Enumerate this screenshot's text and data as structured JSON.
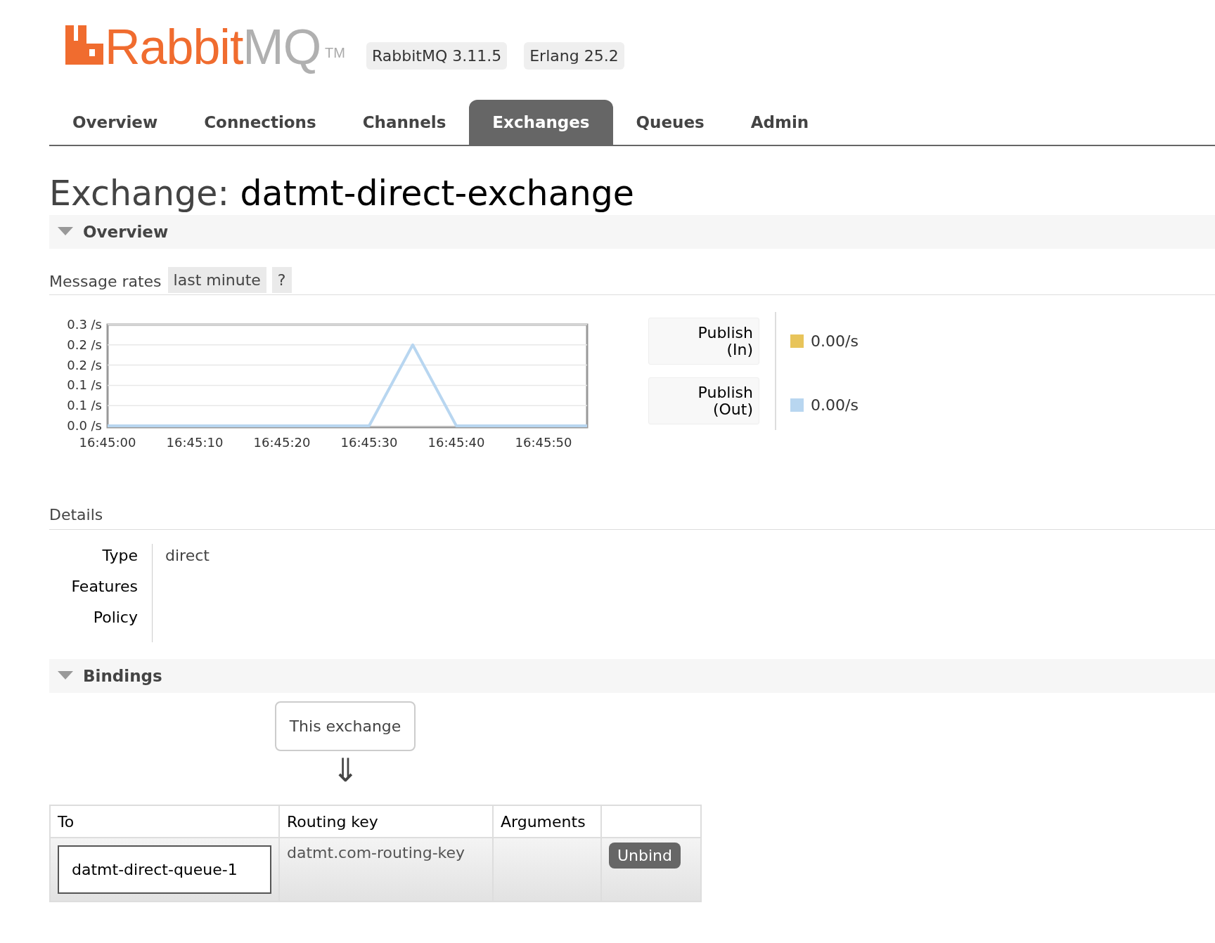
{
  "logo": {
    "text_a": "Rabbit",
    "text_b": "MQ",
    "trademark": "TM"
  },
  "versions": [
    "RabbitMQ 3.11.5",
    "Erlang 25.2"
  ],
  "tabs": [
    {
      "label": "Overview",
      "selected": false
    },
    {
      "label": "Connections",
      "selected": false
    },
    {
      "label": "Channels",
      "selected": false
    },
    {
      "label": "Exchanges",
      "selected": true
    },
    {
      "label": "Queues",
      "selected": false
    },
    {
      "label": "Admin",
      "selected": false
    }
  ],
  "title": {
    "prefix": "Exchange:",
    "name": "datmt-direct-exchange"
  },
  "overview": {
    "heading": "Overview",
    "expanded": true,
    "message_rates": {
      "label": "Message rates",
      "range": "last minute",
      "help": "?",
      "chart_data": {
        "type": "line",
        "ylim": [
          0,
          0.25
        ],
        "grid": true,
        "categories": [
          "16:45:00",
          null,
          "16:45:10",
          null,
          "16:45:20",
          null,
          "16:45:30",
          null,
          "16:45:40",
          null,
          "16:45:50",
          null
        ],
        "yticks": [
          {
            "value": 0,
            "label": "0.0 /s"
          },
          {
            "value": 0.05,
            "label": "0.1 /s"
          },
          {
            "value": 0.1,
            "label": "0.1 /s"
          },
          {
            "value": 0.15,
            "label": "0.2 /s"
          },
          {
            "value": 0.2,
            "label": "0.2 /s"
          },
          {
            "value": 0.25,
            "label": "0.3 /s"
          }
        ],
        "series": [
          {
            "name": "Publish (In)",
            "color": "#e8c45a",
            "values": [
              null,
              null,
              null,
              null,
              null,
              null,
              null,
              null,
              null,
              null,
              null,
              null
            ]
          },
          {
            "name": "Publish (Out)",
            "color": "#b8d6f0",
            "values": [
              0,
              0,
              0,
              0,
              0,
              0,
              0,
              0.2,
              0,
              0,
              0,
              0
            ]
          }
        ]
      },
      "legend": [
        {
          "value": "0.00/s"
        },
        {
          "value": "0.00/s"
        }
      ]
    },
    "details": {
      "heading": "Details",
      "rows": [
        {
          "label": "Type",
          "value": "direct"
        },
        {
          "label": "Features"
        },
        {
          "label": "Policy"
        }
      ]
    }
  },
  "bindings": {
    "heading": "Bindings",
    "expanded": true,
    "source": "This exchange",
    "arrow": "⇓",
    "columns": [
      "To",
      "Routing key",
      "Arguments"
    ],
    "rows": [
      {
        "to": "datmt-direct-queue-1",
        "routing_key": "datmt.com-routing-key",
        "action": "Unbind"
      }
    ]
  }
}
